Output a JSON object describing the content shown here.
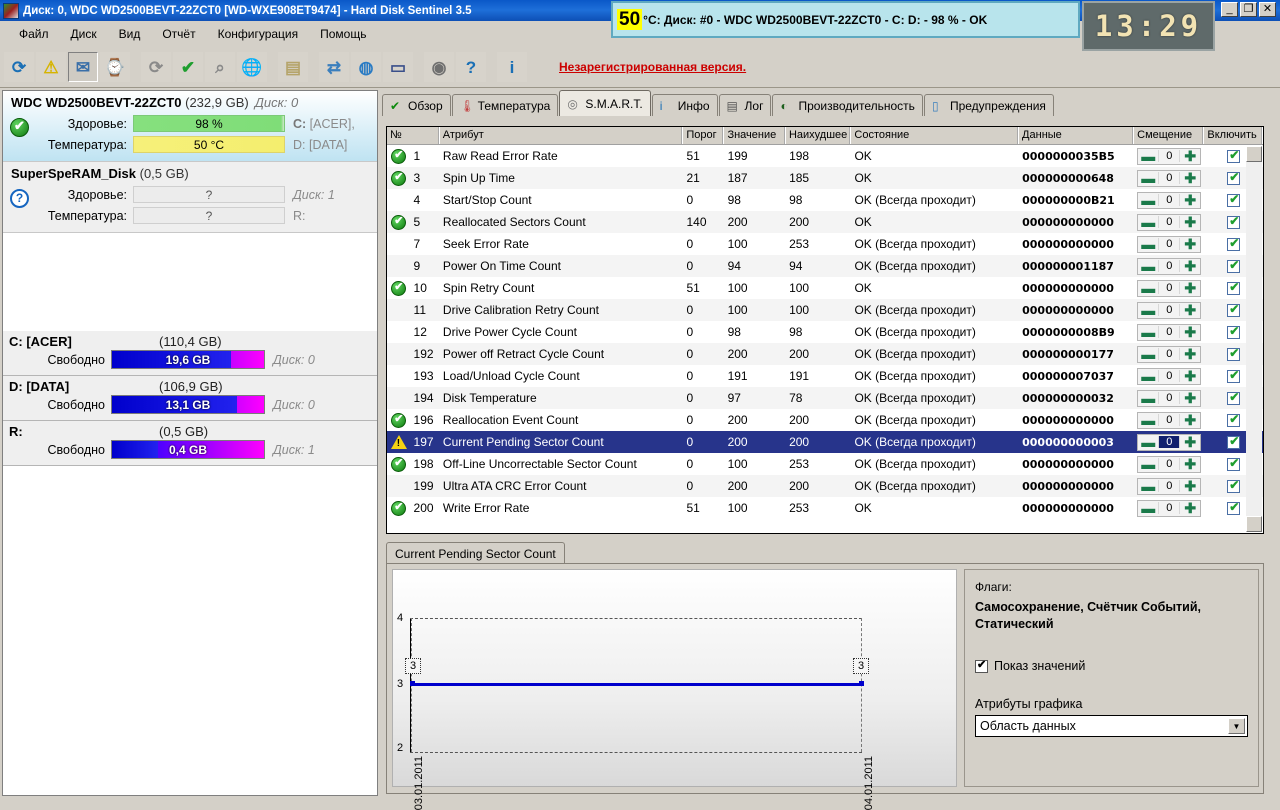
{
  "window": {
    "title": "Диск: 0, WDC WD2500BEVT-22ZCT0 [WD-WXE908ET9474]  -  Hard Disk Sentinel 3.5",
    "minimize": "_",
    "restore": "❐",
    "close": "✕"
  },
  "overlay": {
    "temp_value": "50",
    "text": "°C: Диск: #0 - WDC WD2500BEVT-22ZCT0 - C: D: - 98 % - OK"
  },
  "clock": {
    "time": "13:29"
  },
  "menu": [
    "Файл",
    "Диск",
    "Вид",
    "Отчёт",
    "Конфигурация",
    "Помощь"
  ],
  "toolbar": {
    "unregistered": "Незарегистрированная версия.",
    "buttons": [
      {
        "name": "refresh-icon",
        "glyph": "⟳",
        "color": "#1a6fb5"
      },
      {
        "name": "warning-icon",
        "glyph": "⚠",
        "color": "#d6b400"
      },
      {
        "name": "mail-icon",
        "glyph": "✉",
        "color": "#3a6fa8"
      },
      {
        "name": "disk-clock-icon",
        "glyph": "⌚",
        "color": "#8a8a8a"
      },
      {
        "name": "disk-refresh-icon",
        "glyph": "⟳",
        "color": "#8a8a8a"
      },
      {
        "name": "disk-ok-icon",
        "glyph": "✔",
        "color": "#1e9e2e"
      },
      {
        "name": "disk-search-icon",
        "glyph": "⌕",
        "color": "#8a8a8a"
      },
      {
        "name": "globe-icon",
        "glyph": "🌐",
        "color": "#2b7cc4"
      },
      {
        "name": "report-icon",
        "glyph": "▤",
        "color": "#b5a46a"
      },
      {
        "name": "sync-icon",
        "glyph": "⇄",
        "color": "#3b7fbd"
      },
      {
        "name": "network-globe-icon",
        "glyph": "◍",
        "color": "#2b7cc4"
      },
      {
        "name": "monitor-edit-icon",
        "glyph": "▭",
        "color": "#3a4f8a"
      },
      {
        "name": "sound-icon",
        "glyph": "◉",
        "color": "#6f6f6f"
      },
      {
        "name": "help-icon",
        "glyph": "?",
        "color": "#1a6fb5"
      },
      {
        "name": "info-icon",
        "glyph": "i",
        "color": "#1a6fb5"
      }
    ]
  },
  "sidebar": {
    "disks": [
      {
        "model": "WDC WD2500BEVT-22ZCT0",
        "size": "(232,9 GB)",
        "disk_no": "Диск: 0",
        "health_label": "Здоровье:",
        "health_value": "98 %",
        "temp_label": "Температура:",
        "temp_value": "50 °C",
        "letters_1": "C: [ACER],",
        "letters_2": "D: [DATA]",
        "status": "ok"
      },
      {
        "model": "SuperSpeRAM_Disk",
        "size": "(0,5 GB)",
        "disk_no": "Диск: 1",
        "health_label": "Здоровье:",
        "health_value": "?",
        "temp_label": "Температура:",
        "temp_value": "?",
        "letters_1": "",
        "letters_2": "R:",
        "status": "unknown"
      }
    ],
    "partitions": [
      {
        "letter": "C: [ACER]",
        "size": "(110,4 GB)",
        "free_label": "Свободно",
        "free": "19,6 GB",
        "disk_no": "Диск: 0",
        "fill_pct": 78
      },
      {
        "letter": "D: [DATA]",
        "size": "(106,9 GB)",
        "free_label": "Свободно",
        "free": "13,1 GB",
        "disk_no": "Диск: 0",
        "fill_pct": 82
      },
      {
        "letter": "R:",
        "size": "(0,5 GB)",
        "free_label": "Свободно",
        "free": "0,4 GB",
        "disk_no": "Диск: 1",
        "fill_pct": 30
      }
    ]
  },
  "tabs": [
    {
      "label": "Обзор",
      "icon": "green-check-icon",
      "active": false
    },
    {
      "label": "Температура",
      "icon": "thermometer-icon",
      "active": false
    },
    {
      "label": "S.M.A.R.T.",
      "icon": "disk-platter-icon",
      "active": true
    },
    {
      "label": "Инфо",
      "icon": "info-icon",
      "active": false
    },
    {
      "label": "Лог",
      "icon": "document-icon",
      "active": false
    },
    {
      "label": "Производительность",
      "icon": "gauge-icon",
      "active": false
    },
    {
      "label": "Предупреждения",
      "icon": "page-icon",
      "active": false
    }
  ],
  "table": {
    "headers": [
      "№",
      "Атрибут",
      "Порог",
      "Значение",
      "Наихудшее",
      "Состояние",
      "Данные",
      "Смещение",
      "Включить"
    ],
    "rows": [
      {
        "icon": "ok",
        "id": "1",
        "attr": "Raw Read Error Rate",
        "thr": "51",
        "val": "199",
        "worst": "198",
        "state": "OK",
        "data": "0000000035B5",
        "offset": "0",
        "enabled": true
      },
      {
        "icon": "ok",
        "id": "3",
        "attr": "Spin Up Time",
        "thr": "21",
        "val": "187",
        "worst": "185",
        "state": "OK",
        "data": "000000000648",
        "offset": "0",
        "enabled": true
      },
      {
        "icon": "none",
        "id": "4",
        "attr": "Start/Stop Count",
        "thr": "0",
        "val": "98",
        "worst": "98",
        "state": "OK (Всегда проходит)",
        "data": "000000000B21",
        "offset": "0",
        "enabled": true
      },
      {
        "icon": "ok",
        "id": "5",
        "attr": "Reallocated Sectors Count",
        "thr": "140",
        "val": "200",
        "worst": "200",
        "state": "OK",
        "data": "000000000000",
        "offset": "0",
        "enabled": true
      },
      {
        "icon": "none",
        "id": "7",
        "attr": "Seek Error Rate",
        "thr": "0",
        "val": "100",
        "worst": "253",
        "state": "OK (Всегда проходит)",
        "data": "000000000000",
        "offset": "0",
        "enabled": true
      },
      {
        "icon": "none",
        "id": "9",
        "attr": "Power On Time Count",
        "thr": "0",
        "val": "94",
        "worst": "94",
        "state": "OK (Всегда проходит)",
        "data": "000000001187",
        "offset": "0",
        "enabled": true
      },
      {
        "icon": "ok",
        "id": "10",
        "attr": "Spin Retry Count",
        "thr": "51",
        "val": "100",
        "worst": "100",
        "state": "OK",
        "data": "000000000000",
        "offset": "0",
        "enabled": true
      },
      {
        "icon": "none",
        "id": "11",
        "attr": "Drive Calibration Retry Count",
        "thr": "0",
        "val": "100",
        "worst": "100",
        "state": "OK (Всегда проходит)",
        "data": "000000000000",
        "offset": "0",
        "enabled": true
      },
      {
        "icon": "none",
        "id": "12",
        "attr": "Drive Power Cycle Count",
        "thr": "0",
        "val": "98",
        "worst": "98",
        "state": "OK (Всегда проходит)",
        "data": "0000000008B9",
        "offset": "0",
        "enabled": true
      },
      {
        "icon": "none",
        "id": "192",
        "attr": "Power off Retract Cycle Count",
        "thr": "0",
        "val": "200",
        "worst": "200",
        "state": "OK (Всегда проходит)",
        "data": "000000000177",
        "offset": "0",
        "enabled": true
      },
      {
        "icon": "none",
        "id": "193",
        "attr": "Load/Unload Cycle Count",
        "thr": "0",
        "val": "191",
        "worst": "191",
        "state": "OK (Всегда проходит)",
        "data": "000000007037",
        "offset": "0",
        "enabled": true
      },
      {
        "icon": "none",
        "id": "194",
        "attr": "Disk Temperature",
        "thr": "0",
        "val": "97",
        "worst": "78",
        "state": "OK (Всегда проходит)",
        "data": "000000000032",
        "offset": "0",
        "enabled": true
      },
      {
        "icon": "ok",
        "id": "196",
        "attr": "Reallocation Event Count",
        "thr": "0",
        "val": "200",
        "worst": "200",
        "state": "OK (Всегда проходит)",
        "data": "000000000000",
        "offset": "0",
        "enabled": true
      },
      {
        "icon": "warn",
        "id": "197",
        "attr": "Current Pending Sector Count",
        "thr": "0",
        "val": "200",
        "worst": "200",
        "state": "OK (Всегда проходит)",
        "data": "000000000003",
        "offset": "0",
        "enabled": true,
        "selected": true
      },
      {
        "icon": "ok",
        "id": "198",
        "attr": "Off-Line Uncorrectable Sector Count",
        "thr": "0",
        "val": "100",
        "worst": "253",
        "state": "OK (Всегда проходит)",
        "data": "000000000000",
        "offset": "0",
        "enabled": true
      },
      {
        "icon": "none",
        "id": "199",
        "attr": "Ultra ATA CRC Error Count",
        "thr": "0",
        "val": "200",
        "worst": "200",
        "state": "OK (Всегда проходит)",
        "data": "000000000000",
        "offset": "0",
        "enabled": true
      },
      {
        "icon": "ok",
        "id": "200",
        "attr": "Write Error Rate",
        "thr": "51",
        "val": "100",
        "worst": "253",
        "state": "OK",
        "data": "000000000000",
        "offset": "0",
        "enabled": true
      }
    ]
  },
  "chart_tab": {
    "label": "Current Pending Sector Count"
  },
  "chart_data": {
    "type": "line",
    "title": "Current Pending Sector Count",
    "x": [
      "03.01.2011",
      "04.01.2011"
    ],
    "values": [
      3,
      3
    ],
    "point_labels": [
      "3",
      "3"
    ],
    "ylim": [
      2,
      4
    ],
    "yticks": [
      2,
      3,
      4
    ],
    "xlabel": "",
    "ylabel": "",
    "grid": true,
    "line_color": "#0000cc",
    "legend": "none"
  },
  "flags": {
    "heading": "Флаги:",
    "value": "Самосохранение, Счётчик Событий, Статический",
    "show_values_label": "Показ значений",
    "show_values_checked": true,
    "graph_attr_label": "Атрибуты графика",
    "graph_attr_value": "Область данных"
  }
}
